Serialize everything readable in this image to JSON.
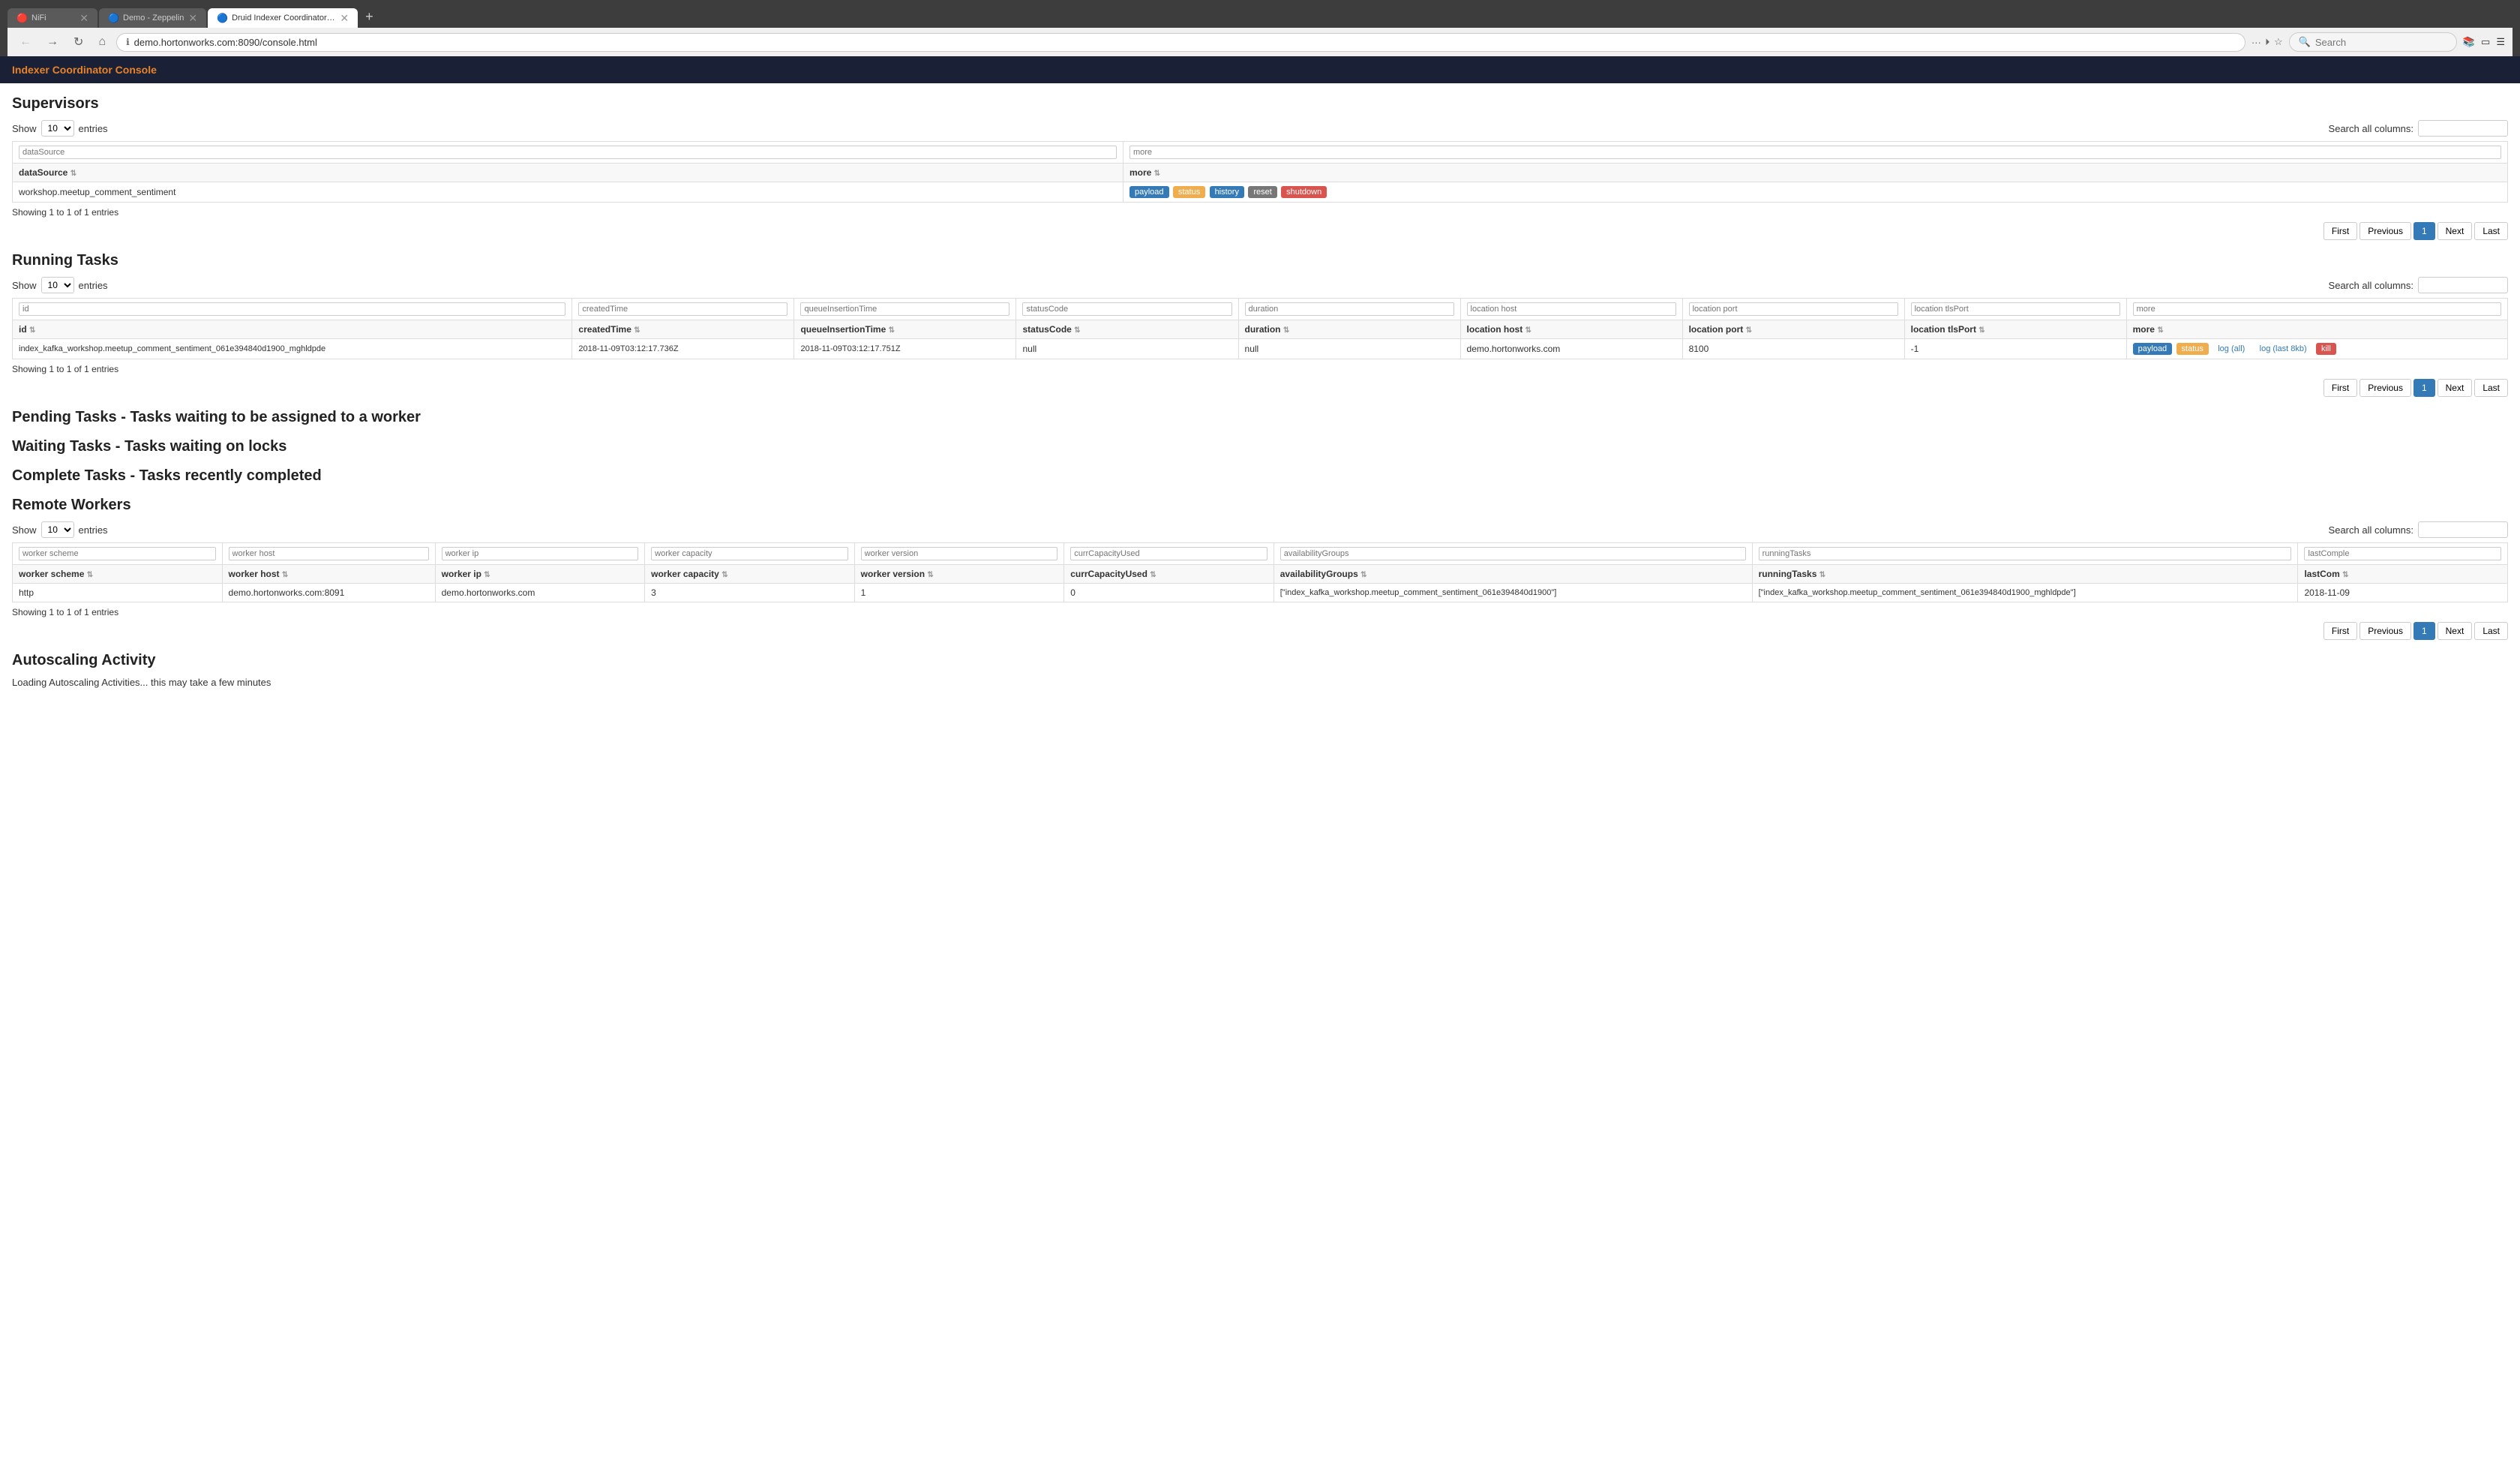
{
  "browser": {
    "tabs": [
      {
        "id": "nifi",
        "title": "NiFi",
        "active": false,
        "favicon": "🔴"
      },
      {
        "id": "zeppelin",
        "title": "Demo - Zeppelin",
        "active": false,
        "favicon": "🔵"
      },
      {
        "id": "druid",
        "title": "Druid Indexer Coordinator Console",
        "active": true,
        "favicon": "🔵"
      }
    ],
    "url": "demo.hortonworks.com:8090/console.html",
    "search_placeholder": "Search"
  },
  "app": {
    "title": "Indexer Coordinator Console"
  },
  "supervisors": {
    "heading": "Supervisors",
    "show_label": "Show",
    "show_value": "10",
    "entries_label": "entries",
    "search_all_label": "Search all columns:",
    "filter_col1": "dataSource",
    "filter_col2": "more",
    "columns": [
      "dataSource",
      "more"
    ],
    "col_headers": [
      {
        "label": "dataSource",
        "sortable": true
      },
      {
        "label": "more",
        "sortable": true
      }
    ],
    "rows": [
      {
        "dataSource": "workshop.meetup_comment_sentiment",
        "actions": [
          "payload",
          "status",
          "history",
          "reset",
          "shutdown"
        ]
      }
    ],
    "showing": "Showing 1 to 1 of 1 entries",
    "pagination": [
      "First",
      "Previous",
      "1",
      "Next",
      "Last"
    ]
  },
  "running_tasks": {
    "heading": "Running Tasks",
    "show_label": "Show",
    "show_value": "10",
    "entries_label": "entries",
    "search_all_label": "Search all columns:",
    "filter_cols": [
      "id",
      "createdTime",
      "queueInsertionTime",
      "statusCode",
      "duration",
      "location host",
      "location port",
      "location tlsPort",
      "more"
    ],
    "col_headers": [
      {
        "label": "id",
        "sortable": true
      },
      {
        "label": "createdTime",
        "sortable": true
      },
      {
        "label": "queueInsertionTime",
        "sortable": true
      },
      {
        "label": "statusCode",
        "sortable": true
      },
      {
        "label": "duration",
        "sortable": true
      },
      {
        "label": "location host",
        "sortable": true
      },
      {
        "label": "location port",
        "sortable": true
      },
      {
        "label": "location tlsPort",
        "sortable": true
      },
      {
        "label": "more",
        "sortable": true
      }
    ],
    "rows": [
      {
        "id": "index_kafka_workshop.meetup_comment_sentiment_061e394840d1900_mghldpde",
        "createdTime": "2018-11-09T03:12:17.736Z",
        "queueInsertionTime": "2018-11-09T03:12:17.751Z",
        "statusCode": "null",
        "duration": "null",
        "location_host": "demo.hortonworks.com",
        "location_port": "8100",
        "location_tlsPort": "-1",
        "actions": [
          "payload",
          "status",
          "log (all)",
          "log (last 8kb)",
          "kill"
        ]
      }
    ],
    "showing": "Showing 1 to 1 of 1 entries",
    "pagination": [
      "First",
      "Previous",
      "1",
      "Next",
      "Last"
    ]
  },
  "pending_tasks": {
    "heading": "Pending Tasks - Tasks waiting to be assigned to a worker"
  },
  "waiting_tasks": {
    "heading": "Waiting Tasks - Tasks waiting on locks"
  },
  "complete_tasks": {
    "heading": "Complete Tasks - Tasks recently completed"
  },
  "remote_workers": {
    "heading": "Remote Workers",
    "show_label": "Show",
    "show_value": "10",
    "entries_label": "entries",
    "search_all_label": "Search all columns:",
    "filter_cols": [
      "worker scheme",
      "worker host",
      "worker ip",
      "worker capacity",
      "worker version",
      "currCapacityUsed",
      "availabilityGroups",
      "runningTasks",
      "lastComple"
    ],
    "col_headers": [
      {
        "label": "worker scheme",
        "sortable": true
      },
      {
        "label": "worker host",
        "sortable": true
      },
      {
        "label": "worker ip",
        "sortable": true
      },
      {
        "label": "worker capacity",
        "sortable": true
      },
      {
        "label": "worker version",
        "sortable": true
      },
      {
        "label": "currCapacityUsed",
        "sortable": true
      },
      {
        "label": "availabilityGroups",
        "sortable": true
      },
      {
        "label": "runningTasks",
        "sortable": true
      },
      {
        "label": "lastCom",
        "sortable": true
      }
    ],
    "rows": [
      {
        "worker_scheme": "http",
        "worker_host": "demo.hortonworks.com:8091",
        "worker_ip": "demo.hortonworks.com",
        "worker_capacity": "3",
        "worker_version": "1",
        "currCapacityUsed": "0",
        "availabilityGroups": "[\"index_kafka_workshop.meetup_comment_sentiment_061e394840d1900\"]",
        "runningTasks": "[\"index_kafka_workshop.meetup_comment_sentiment_061e394840d1900_mghldpde\"]",
        "lastCom": "2018-11-09"
      }
    ],
    "showing": "Showing 1 to 1 of 1 entries",
    "pagination": [
      "First",
      "Previous",
      "1",
      "Next",
      "Last"
    ]
  },
  "autoscaling": {
    "heading": "Autoscaling Activity",
    "loading": "Loading Autoscaling Activities... this may take a few minutes"
  },
  "colors": {
    "badge_blue": "#337ab7",
    "badge_yellow": "#e8a838",
    "badge_green": "#5cb85c",
    "badge_red": "#d9534f",
    "header_bg": "#1a2035",
    "accent": "#e8832a"
  }
}
